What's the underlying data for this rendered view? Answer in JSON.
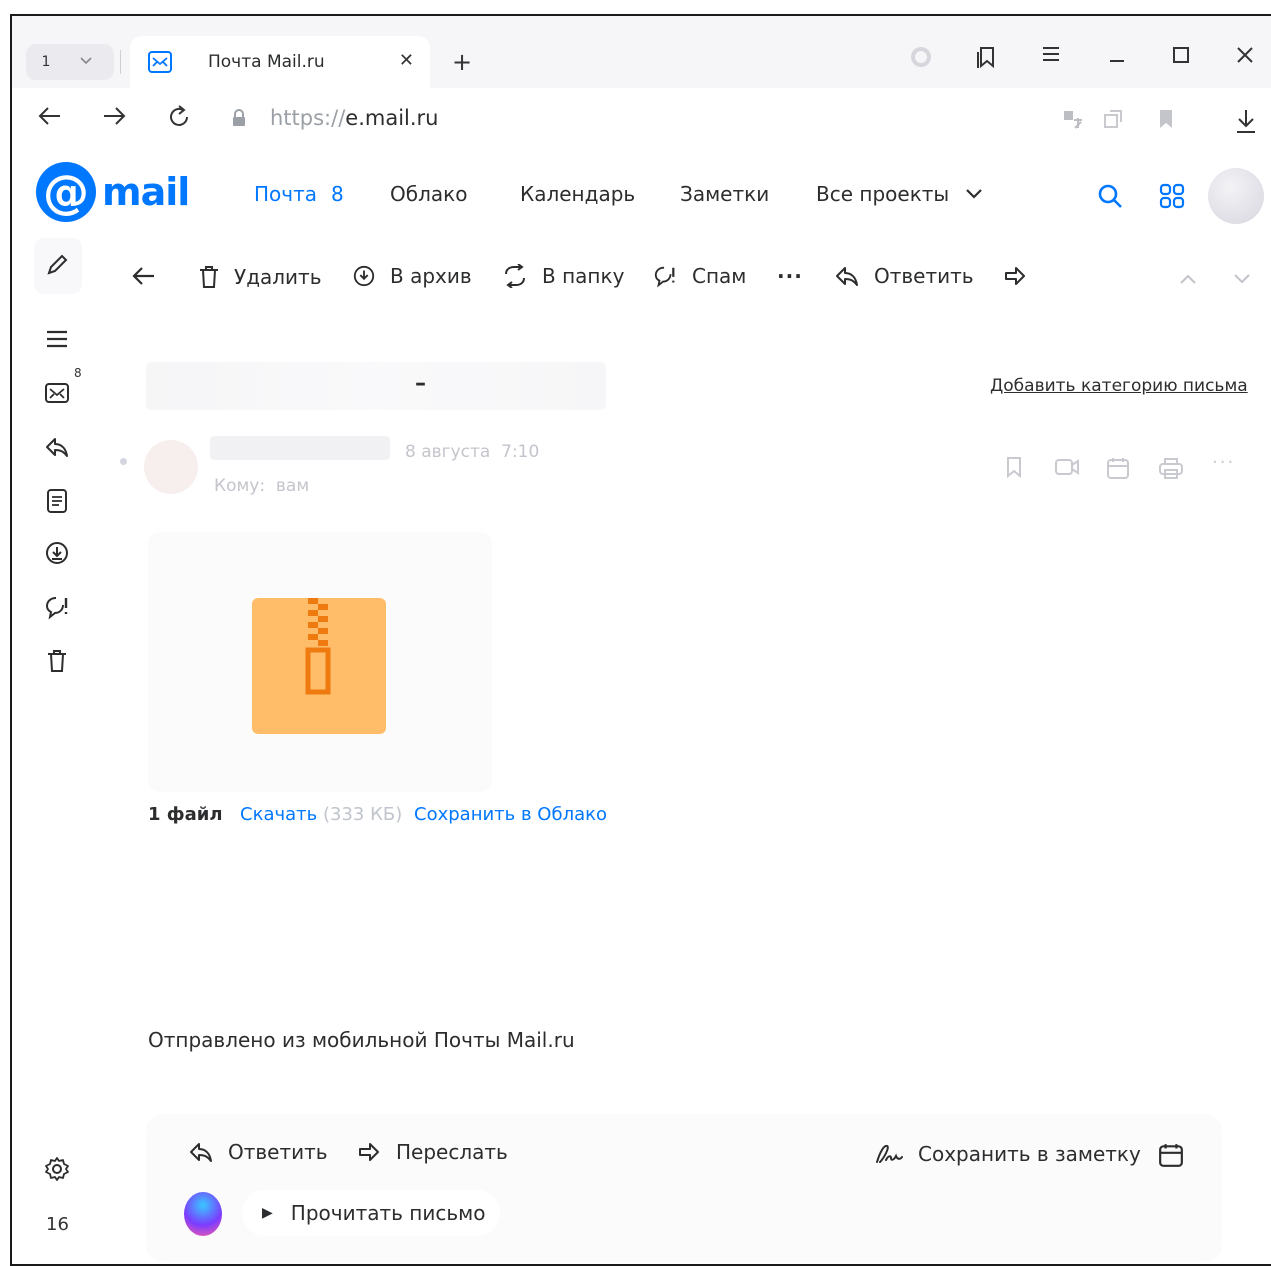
{
  "browser": {
    "tab_count": "1",
    "tab_title": "Почта Mail.ru",
    "url_protocol": "https://",
    "url_host": "e.mail.ru"
  },
  "mail": {
    "logo_text": "mail",
    "nav": {
      "pochta": "Почта",
      "pochta_count": "8",
      "cloud": "Облако",
      "calendar": "Календарь",
      "notes": "Заметки",
      "all_projects": "Все проекты"
    },
    "sidebar": {
      "inbox_badge": "8",
      "bottom_count": "16"
    },
    "toolbar": {
      "delete": "Удалить",
      "archive": "В архив",
      "to_folder": "В папку",
      "spam": "Спам",
      "more": "···",
      "reply": "Ответить"
    },
    "message": {
      "subject_dash": "–",
      "add_category": "Добавить категорию письма",
      "date": "8 августа",
      "time": "7:10",
      "to_label": "Кому:",
      "to_value": "вам",
      "more": "···"
    },
    "attachment": {
      "files_count": "1 файл",
      "download": "Скачать",
      "size": "(333 КБ)",
      "save_cloud": "Сохранить в Облако"
    },
    "body_text": "Отправлено из мобильной Почты Mail.ru",
    "bottom": {
      "reply": "Ответить",
      "forward": "Переслать",
      "save_note": "Сохранить в заметку",
      "read_letter": "Прочитать письмо"
    }
  },
  "colors": {
    "accent": "#0077ff",
    "zip": "#ffbd6a",
    "zip_zipper": "#ee7a10"
  }
}
